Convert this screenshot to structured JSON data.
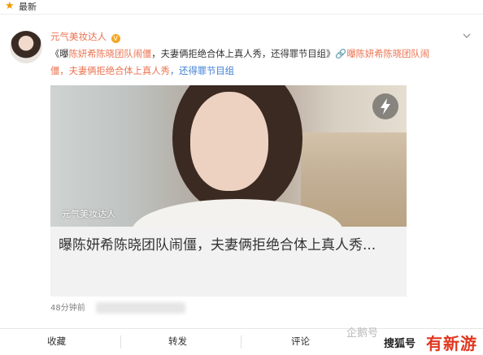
{
  "topbar": {
    "label": "最新",
    "star_icon": "★"
  },
  "post": {
    "author": "元气美妆达人",
    "vip_badge": "V",
    "line1_prefix": "《曝",
    "line1_link": "陈妍希陈晓团队闹僵",
    "line1_text": "，夫妻俩拒绝合体上真人秀，还得罪节目组》",
    "line1_tail_link": "曝陈妍希陈晓团队闹",
    "line2_orange": "僵，夫妻俩拒绝合体上真人秀",
    "line2_blue": "，还得罪节目组"
  },
  "card": {
    "image_caption": "元气美妆达人",
    "title": "曝陈妍希陈晓团队闹僵，夫妻俩拒绝合体上真人秀..."
  },
  "meta": {
    "timestamp": "48分钟前"
  },
  "actions": {
    "favorite": "收藏",
    "repost": "转发",
    "comment": "评论"
  },
  "watermark": {
    "text": "企鹅号",
    "badge_source": "搜狐号",
    "badge_fun": "有新游"
  },
  "colors": {
    "accent_orange": "#eb7350",
    "link_blue": "#3d7ed4",
    "badge_red": "#e0361e"
  }
}
